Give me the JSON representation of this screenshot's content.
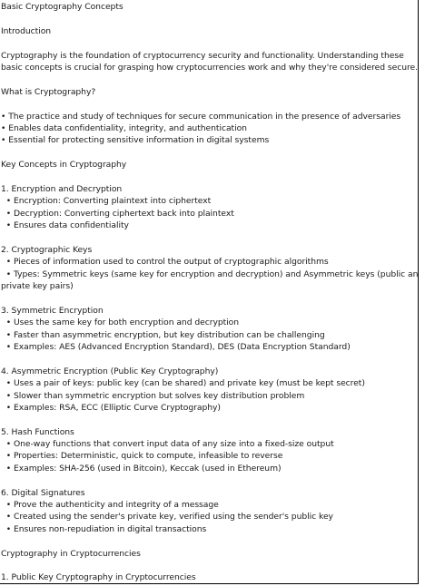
{
  "title": "Basic Cryptography Concepts",
  "intro_heading": "Introduction",
  "intro_text_1": "Cryptography is the foundation of cryptocurrency security and functionality. Understanding these",
  "intro_text_2": "basic concepts is crucial for grasping how cryptocurrencies work and why they're considered secure.",
  "what_heading": "What is Cryptography?",
  "what_items": [
    "• The practice and study of techniques for secure communication in the presence of adversaries",
    "• Enables data confidentiality, integrity, and authentication",
    "• Essential for protecting sensitive information in digital systems"
  ],
  "key_heading": "Key Concepts in Cryptography",
  "sections": [
    {
      "heading": "1. Encryption and Decryption",
      "items": [
        "  • Encryption: Converting plaintext into ciphertext",
        "  • Decryption: Converting ciphertext back into plaintext",
        "  • Ensures data confidentiality"
      ]
    },
    {
      "heading": "2. Cryptographic Keys",
      "items": [
        "  • Pieces of information used to control the output of cryptographic algorithms",
        "  • Types: Symmetric keys (same key for encryption and decryption) and Asymmetric keys (public and",
        "private key pairs)"
      ]
    },
    {
      "heading": "3. Symmetric Encryption",
      "items": [
        "  • Uses the same key for both encryption and decryption",
        "  • Faster than asymmetric encryption, but key distribution can be challenging",
        "  • Examples: AES (Advanced Encryption Standard), DES (Data Encryption Standard)"
      ]
    },
    {
      "heading": "4. Asymmetric Encryption (Public Key Cryptography)",
      "items": [
        "  • Uses a pair of keys: public key (can be shared) and private key (must be kept secret)",
        "  • Slower than symmetric encryption but solves key distribution problem",
        "  • Examples: RSA, ECC (Elliptic Curve Cryptography)"
      ]
    },
    {
      "heading": "5. Hash Functions",
      "items": [
        "  • One-way functions that convert input data of any size into a fixed-size output",
        "  • Properties: Deterministic, quick to compute, infeasible to reverse",
        "  • Examples: SHA-256 (used in Bitcoin), Keccak (used in Ethereum)"
      ]
    },
    {
      "heading": "6. Digital Signatures",
      "items": [
        "  • Prove the authenticity and integrity of a message",
        "  • Created using the sender's private key, verified using the sender's public key",
        "  • Ensures non-repudiation in digital transactions"
      ]
    }
  ],
  "crypto_heading": "Cryptography in Cryptocurrencies",
  "crypto_sub_1": "1. Public Key Cryptography in Cryptocurrencies"
}
